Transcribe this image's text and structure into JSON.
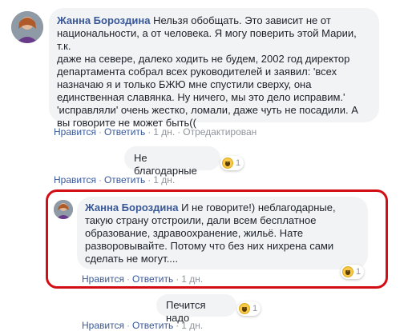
{
  "comments": [
    {
      "author": "Жанна Бороздина",
      "lines": [
        "Нельзя обобщать. Это зависит не от",
        "национальности, а от человека. Я могу поверить этой Марии, т.к.",
        "даже на севере, далеко ходить не будем, 2002 год директор",
        "департамента собрал всех руководителей и заявил: 'всех",
        "назначаю я и только БЖЮ мне спустили сверху, она",
        "единственная славянка. Ну ничего, мы это дело исправим.'",
        "'исправляли' очень жестко, ломали, даже чуть не посадили. А",
        "вы говорите не может быть(("
      ],
      "actions": {
        "like": "Нравится",
        "reply": "Ответить",
        "time": "1 дн.",
        "edited": "Отредактирован"
      }
    },
    {
      "author": "",
      "text": "Не благодарные",
      "reaction": {
        "icon": "haha-emoji-icon",
        "count": "1"
      },
      "actions": {
        "like": "Нравится",
        "reply": "Ответить",
        "time": "1 дн."
      }
    },
    {
      "author": "Жанна Бороздина",
      "lines": [
        "И не говорите!) неблагодарные,",
        "такую страну отстроили, дали всем бесплатное",
        "образование, здравоохранение, жильё. Нате",
        "разворовывайте. Потому что без них нихрена сами",
        "сделать не могут...."
      ],
      "reaction": {
        "icon": "haha-emoji-icon",
        "count": "1"
      },
      "actions": {
        "like": "Нравится",
        "reply": "Ответить",
        "time": "1 дн."
      }
    },
    {
      "author": "",
      "text": "Печится надо",
      "reaction": {
        "icon": "haha-emoji-icon",
        "count": "1"
      },
      "actions": {
        "like": "Нравится",
        "reply": "Ответить",
        "time": "1 дн."
      }
    }
  ],
  "colors": {
    "link": "#385898",
    "bubble": "#f2f3f5",
    "highlight": "#d20e14",
    "muted": "#90949c"
  }
}
